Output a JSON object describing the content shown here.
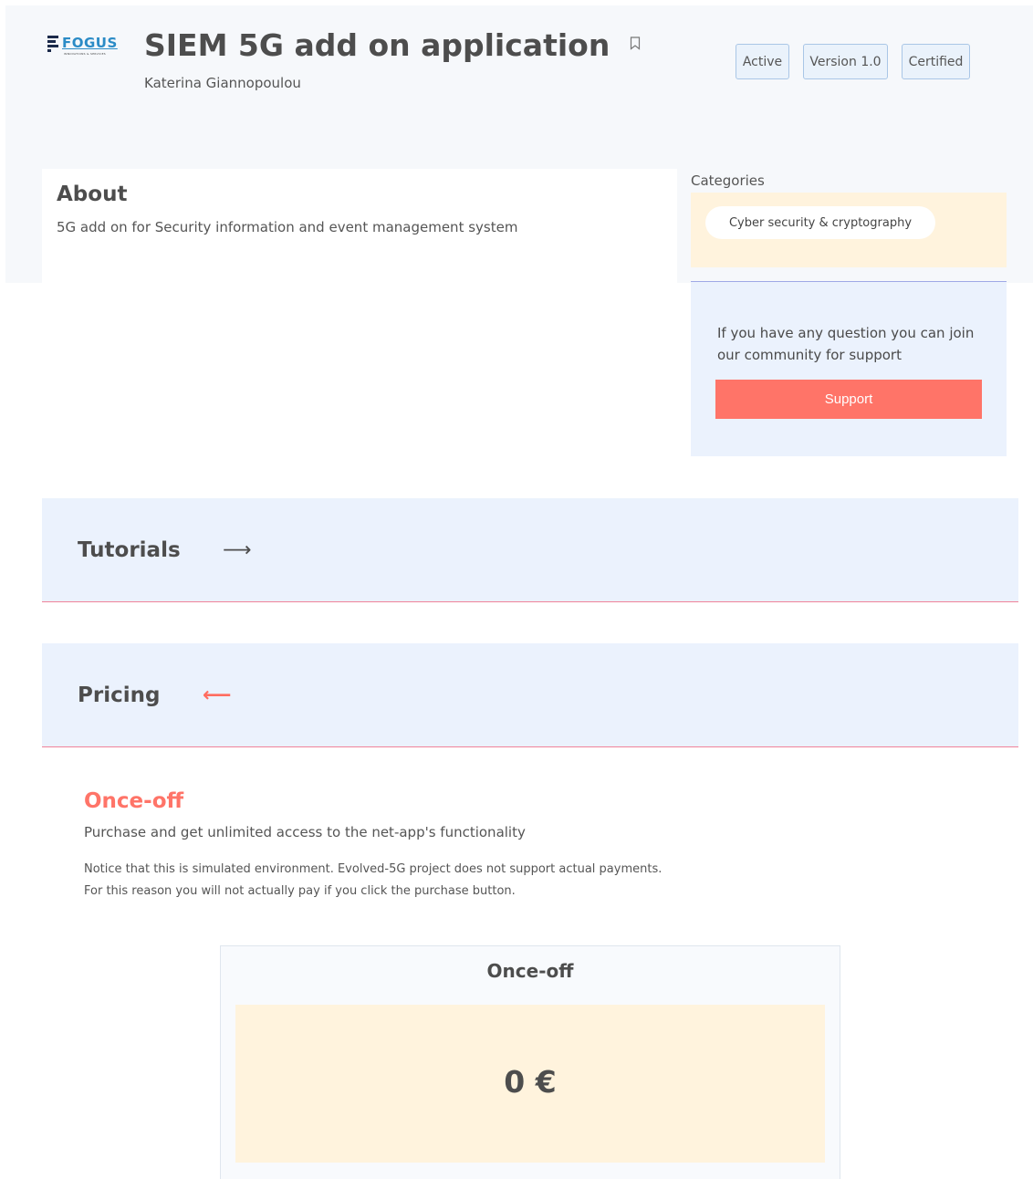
{
  "header": {
    "logo": {
      "name": "FOGUS",
      "tagline": "INNOVATIONS & SERVICES"
    },
    "title": "SIEM 5G add on application",
    "author": "Katerina Giannopoulou",
    "badges": [
      "Active",
      "Version 1.0",
      "Certified"
    ]
  },
  "about": {
    "title": "About",
    "description": "5G add on for Security information and event management system"
  },
  "categories": {
    "label": "Categories",
    "items": [
      "Cyber security & cryptography"
    ]
  },
  "support": {
    "text": "If you have any question you can join our community for support",
    "button_label": "Support"
  },
  "sections": {
    "tutorials": {
      "title": "Tutorials",
      "arrow": "⟶"
    },
    "pricing": {
      "title": "Pricing",
      "arrow": "⟵"
    }
  },
  "pricing": {
    "plan_title": "Once-off",
    "plan_description": "Purchase and get unlimited access to the net-app's functionality",
    "notice_line1": "Notice that this is simulated environment. Evolved-5G project does not support actual payments.",
    "notice_line2": "For this reason you will not actually pay if you click the purchase button.",
    "card_title": "Once-off",
    "price": "0 €"
  },
  "colors": {
    "accent": "#ff7468",
    "section_bg": "#ebf2fd",
    "category_bg": "#fff3dd"
  }
}
